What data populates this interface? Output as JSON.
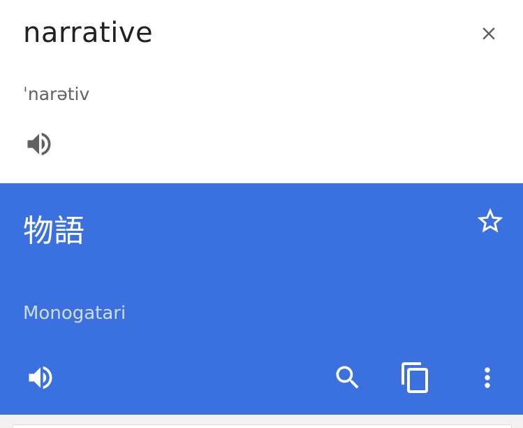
{
  "source": {
    "text": "narrative",
    "phonetic": "ˈnarətiv",
    "close_icon": "close-icon",
    "speak_icon": "volume-icon"
  },
  "translation": {
    "text": "物語",
    "romanization": "Monogatari",
    "star_icon": "star-outline-icon",
    "actions": [
      "volume-icon",
      "search-icon",
      "copy-icon",
      "more-vert-icon"
    ]
  },
  "colors": {
    "card_background": "#3b71df",
    "source_background": "#ffffff",
    "source_text": "#212121",
    "phonetic_text": "#616161",
    "romanization_text": "#cfdcf7",
    "icon_gray": "#616161",
    "icon_white": "#ffffff"
  }
}
